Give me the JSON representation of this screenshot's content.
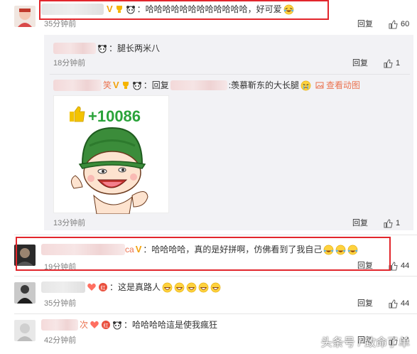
{
  "comments": [
    {
      "text": "：哈哈哈哈哈哈哈哈哈哈哈哈，好可爱",
      "time": "35分钟前",
      "reply": "回复",
      "likes": "60"
    },
    {
      "text": "：哈哈哈哈，真的是好拼啊，仿佛看到了我自己",
      "time": "19分钟前",
      "reply": "回复",
      "likes": "44"
    },
    {
      "text": "：这是真路人",
      "time": "35分钟前",
      "reply": "回复",
      "likes": "44"
    },
    {
      "text": "：哈哈哈哈這是使我瘋狂",
      "time": "42分钟前",
      "reply": "回复",
      "likes": "44"
    }
  ],
  "subreplies": [
    {
      "text": "：腿长两米八",
      "time": "18分钟前",
      "reply": "回复",
      "likes": "1"
    },
    {
      "name_fragment": "笑",
      "text_prefix": "：回复",
      "text_suffix": ":羡慕靳东的大长腿",
      "gif_link": "查看动图",
      "sticker_text": "+10086",
      "time": "13分钟前",
      "reply": "回复",
      "likes": "1"
    }
  ],
  "partial_names": {
    "c1_end": "a",
    "c2_end": "ca",
    "c4_end": "次"
  },
  "watermark": "头条号 / 致命了单",
  "colors": {
    "highlight_border": "#e2262c",
    "vip_gold": "#f2a20c",
    "link_orange": "#eb7350"
  }
}
